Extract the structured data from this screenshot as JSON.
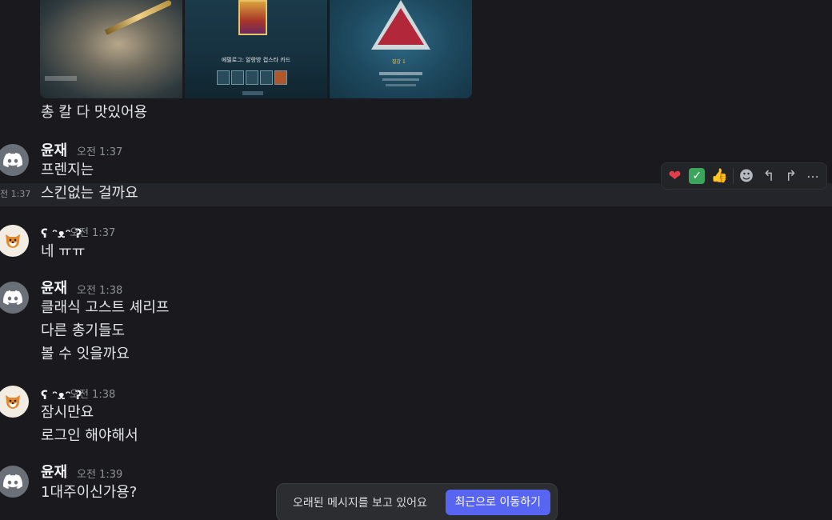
{
  "messages": {
    "m0": {
      "line1": "총 칼 다 맛있어용"
    },
    "m1": {
      "author": "윤재",
      "time": "오전 1:37",
      "line1": "프렌지는",
      "line2": "스킨없는 걸까요",
      "hover_time": "전 1:37"
    },
    "m2": {
      "author": "ʕ ᵔᴥᵔ ʔ",
      "time": "오전 1:37",
      "line1": "네 ㅠㅠ"
    },
    "m3": {
      "author": "윤재",
      "time": "오전 1:38",
      "line1": "클래식 고스트 셰리프",
      "line2": "다른 총기들도",
      "line3": "볼 수 잇을까요"
    },
    "m4": {
      "author": "ʕ ᵔᴥᵔ ʔ",
      "time": "오전 1:38",
      "line1": "잠시만요",
      "line2": "로그인 해야해서"
    },
    "m5": {
      "author": "윤재",
      "time": "오전 1:39",
      "line1": "1대주이신가용?"
    }
  },
  "attachments": {
    "card_caption": "에필로그: 알랑방 컵스타 카드",
    "badge_text": "질감 1"
  },
  "toolbar": {
    "icons": [
      "heart-emoji",
      "check-emoji",
      "thumbs-up-emoji",
      "add-reaction-icon",
      "reply-icon",
      "forward-icon",
      "more-icon"
    ],
    "glyph_heart": "❤",
    "glyph_check": "✓",
    "glyph_thumb": "👍",
    "glyph_react": "☻",
    "glyph_reply": "↰",
    "glyph_forward": "↱",
    "glyph_more": "⋯"
  },
  "jump_bar": {
    "message": "오래된 메시지를 보고 있어요",
    "button_label": "최근으로 이동하기",
    "button_color": "#5865f2"
  }
}
